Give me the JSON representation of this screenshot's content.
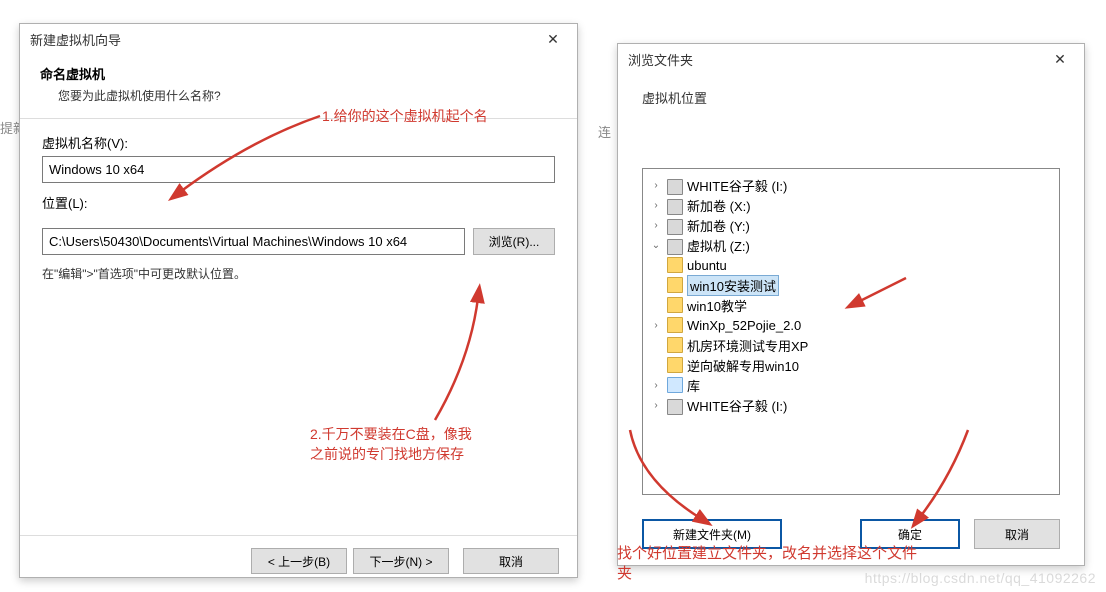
{
  "wizard": {
    "title": "新建虚拟机向导",
    "heading": "命名虚拟机",
    "subheading": "您要为此虚拟机使用什么名称?",
    "name_label": "虚拟机名称(V):",
    "name_value": "Windows 10 x64",
    "location_label": "位置(L):",
    "location_value": "C:\\Users\\50430\\Documents\\Virtual Machines\\Windows 10 x64",
    "browse_btn": "浏览(R)...",
    "hint": "在\"编辑\">\"首选项\"中可更改默认位置。",
    "back": "< 上一步(B)",
    "next": "下一步(N) >",
    "cancel": "取消"
  },
  "browse": {
    "title": "浏览文件夹",
    "subtitle": "虚拟机位置",
    "tree": {
      "n0": "WHITE谷子毅 (I:)",
      "n1": "新加卷 (X:)",
      "n2": "新加卷 (Y:)",
      "n3": "虚拟机 (Z:)",
      "n3_0": "ubuntu",
      "n3_1": "win10安装测试",
      "n3_2": "win10教学",
      "n3_3": "WinXp_52Pojie_2.0",
      "n3_4": "机房环境测试专用XP",
      "n3_5": "逆向破解专用win10",
      "n4": "库",
      "n5": "WHITE谷子毅 (I:)"
    },
    "newfolder": "新建文件夹(M)",
    "ok": "确定",
    "cancel": "取消"
  },
  "annot": {
    "a1": "1.给你的这个虚拟机起个名",
    "a2a": "2.千万不要装在C盘，像我",
    "a2b": "之前说的专门找地方保存",
    "a3a": "找个好位置建立文件夹，改名并选择这个文件",
    "a3b": "夹"
  },
  "bg": {
    "left": "提新",
    "right": "连"
  },
  "watermark": "https://blog.csdn.net/qq_41092262"
}
